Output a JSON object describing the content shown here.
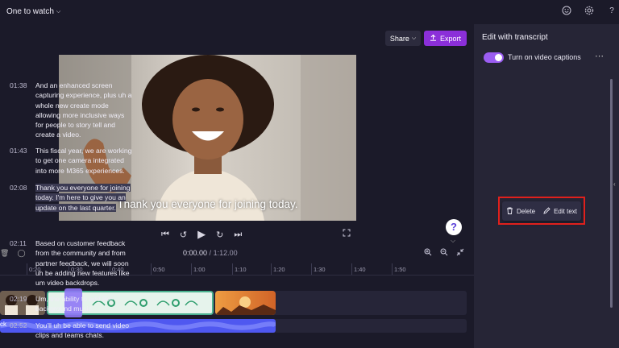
{
  "topbar": {
    "project_title": "One to watch",
    "icons": [
      "smiley-icon",
      "gear-icon",
      "help-icon"
    ]
  },
  "preview": {
    "share_label": "Share",
    "export_label": "Export",
    "caption": "Thank you everyone for joining today.",
    "help_label": "?"
  },
  "playback": {
    "current_time": "0:00.00",
    "duration": "1:12.00"
  },
  "timeline": {
    "ticks": [
      "0:20",
      "0:30",
      "0:40",
      "0:50",
      "1:00",
      "1:10",
      "1:20",
      "1:30",
      "1:40",
      "1:50"
    ],
    "audio_label": "ck"
  },
  "transcript_panel": {
    "title": "Edit with transcript",
    "caption_toggle_label": "Turn on video captions",
    "caption_toggle_on": true,
    "entries": [
      {
        "time": "01:38",
        "text": "And an enhanced screen capturing experience, plus uh a whole new create mode allowing more inclusive ways for people to story tell and create a video."
      },
      {
        "time": "01:43",
        "text": "This fiscal year, we are working to get one camera integrated into more M365 experiences."
      },
      {
        "time": "02:08",
        "text": "Thank you everyone for joining today. I'm here to give you an update on the last quarter."
      },
      {
        "time": "02:11",
        "text": "Based on customer feedback from the community and from partner feedback, we will soon uh be adding new features like um video backdrops."
      },
      {
        "time": "02:19",
        "text": "Um, the ability to add like background music."
      },
      {
        "time": "02:52",
        "text": "You'll uh be able to send video clips and teams chats."
      }
    ],
    "context_menu": {
      "delete_label": "Delete",
      "edit_label": "Edit text"
    }
  },
  "colors": {
    "accent": "#8b2fd9",
    "toggle": "#9b5df2",
    "highlight_outline": "#e0201c"
  }
}
